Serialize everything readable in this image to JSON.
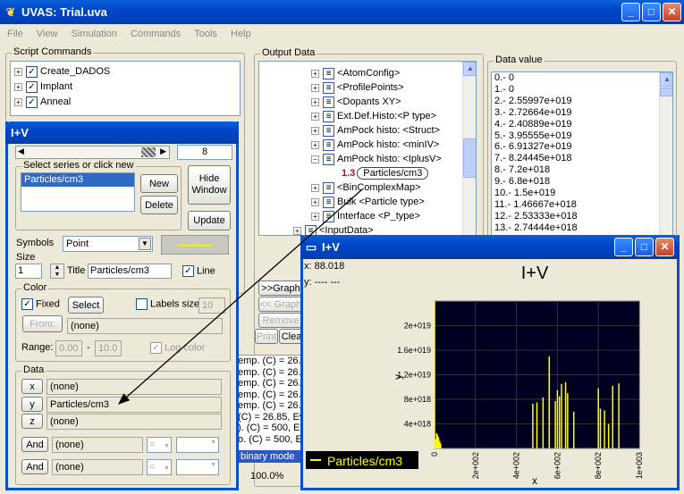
{
  "main_window": {
    "title": "UVAS: Trial.uva",
    "menu": [
      "File",
      "View",
      "Simulation",
      "Commands",
      "Tools",
      "Help"
    ]
  },
  "script_commands": {
    "label": "Script Commands",
    "items": [
      "Create_DADOS",
      "Implant",
      "Anneal"
    ]
  },
  "output_data": {
    "label": "Output Data",
    "tree": [
      "<AtomConfig>",
      "<ProfilePoints>",
      "<Dopants XY>",
      "Ext.Def.Histo:<P type>",
      "AmPock histo: <Struct>",
      "AmPock histo: <minIV>",
      "AmPock histo: <IplusV>",
      "Particles/cm3",
      "<BinComplexMap>",
      "Bulk <Particle type>",
      "Interface <P_type>",
      "<InputData>"
    ],
    "highlight_badge": "1.3",
    "buttons": [
      ">>Graph",
      "<< Graph",
      "Remove",
      "Print",
      "Clea"
    ],
    "log": [
      "emp. (C) = 26.",
      "emp. (C) = 26.",
      "emp. (C) = 26.85, E",
      "emp. (C) = 26.",
      "emp. (C) = 26.85, E",
      "(C) = 26.85, Ev",
      "). (C) = 500, Ev",
      "o. (C) = 500, Ev"
    ],
    "status_mode": "binary mode",
    "zoom": "100.0%"
  },
  "data_value": {
    "label": "Data value",
    "rows": [
      "0.-  0",
      "1.-  0",
      "2.-  2.55997e+019",
      "3.-  2.72664e+019",
      "4.-  2.40889e+019",
      "5.-  3.95555e+019",
      "6.-  6.91327e+019",
      "7.-  8.24445e+018",
      "8.-  7.2e+018",
      "9.-  6.8e+018",
      "10.-  1.5e+019",
      "11.-  1.46667e+018",
      "12.-  2.53333e+018",
      "13.-  2.74444e+018"
    ]
  },
  "iv_dialog": {
    "title": "I+V",
    "counter": "8",
    "series_label": "Select series or click new",
    "series_items": [
      "Particles/cm3"
    ],
    "new_label": "New",
    "delete_label": "Delete",
    "hide_label": "Hide Window",
    "update_label": "Update",
    "symbols_label": "Symbols",
    "symbols_value": "Point",
    "size_label": "Size",
    "size_value": "1",
    "title_label": "Title",
    "title_value": "Particles/cm3",
    "line_label": "Line",
    "color_label": "Color",
    "fixed_label": "Fixed",
    "select_label": "Select",
    "labels_label": "Labels size",
    "labels_value": "10",
    "from_label": "From:",
    "from_value": "(none)",
    "range_label": "Range:",
    "range_min": "0.00",
    "range_dash": "-",
    "range_max": "10.0",
    "logcolor_label": "Log color",
    "data_label": "Data",
    "x_btn": "x",
    "x_value": "(none)",
    "y_btn": "y",
    "y_value": "Particles/cm3",
    "z_btn": "z",
    "z_value": "(none)",
    "and_label": "And",
    "and1_value": "(none)",
    "and2_value": "(none)",
    "eq_symbol": "="
  },
  "plot_window": {
    "title": "I+V",
    "x_readout": "x: 88.018",
    "y_readout": "y:  ----  ---",
    "chart_title": "I+V",
    "legend": "Particles/cm3"
  },
  "chart_data": {
    "type": "bar",
    "title": "I+V",
    "xlabel": "x",
    "ylabel": "y",
    "xlim": [
      0,
      1000
    ],
    "ylim": [
      0,
      2.4e+19
    ],
    "x_ticks": [
      "0",
      "2e+002",
      "4e+002",
      "6e+002",
      "8e+002",
      "1e+003"
    ],
    "y_ticks": [
      "4e+018",
      "8e+018",
      "1.2e+019",
      "1.6e+019",
      "2e+019"
    ],
    "series": [
      {
        "name": "Particles/cm3",
        "color": "#ffff00",
        "x": [
          5,
          10,
          15,
          20,
          25,
          30,
          480,
          500,
          530,
          560,
          590,
          600,
          610,
          620,
          640,
          650,
          680,
          800,
          810,
          830,
          850,
          870,
          900
        ],
        "values": [
          1.5e+18,
          2.5e+18,
          2.2e+18,
          1.8e+18,
          1.2e+18,
          8e+17,
          7.3e+18,
          7.5e+18,
          8.3e+18,
          1.5e+19,
          7.7e+18,
          9.5e+18,
          8.5e+18,
          1.05e+19,
          1.08e+19,
          9e+18,
          6e+18,
          9.8e+18,
          6.5e+18,
          6.2e+18,
          4e+18,
          1.02e+19,
          1.06e+19
        ]
      }
    ]
  }
}
